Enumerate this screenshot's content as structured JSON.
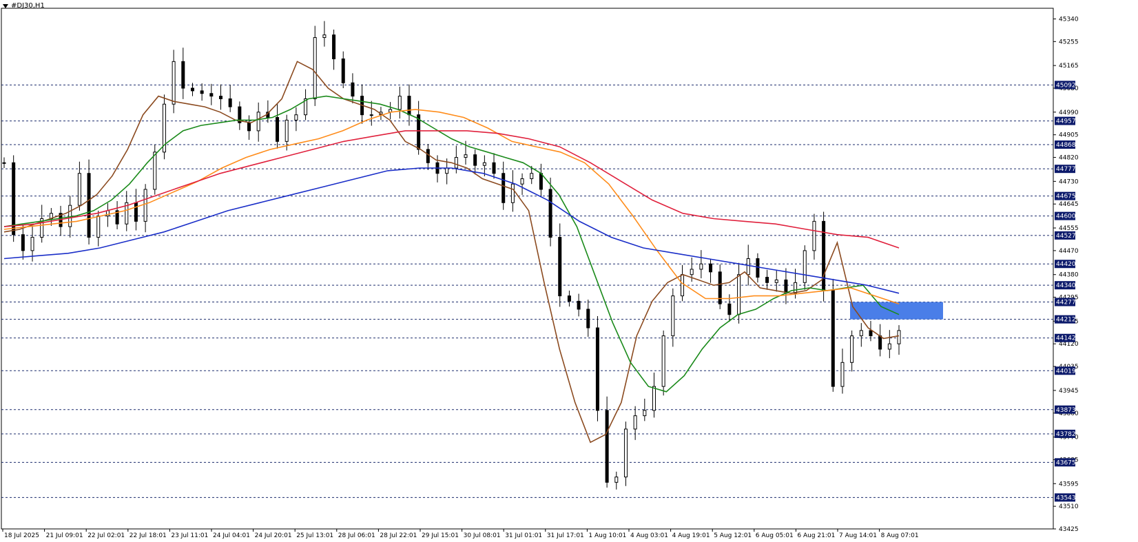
{
  "window": {
    "symbol_title": "#DJ30,H1"
  },
  "chart_data": {
    "type": "candlestick",
    "title": "#DJ30,H1",
    "ylim": [
      43425,
      45380
    ],
    "x_tick_labels": [
      "18 Jul 2025",
      "21 Jul 09:01",
      "22 Jul 02:01",
      "22 Jul 18:01",
      "23 Jul 11:01",
      "24 Jul 04:01",
      "24 Jul 20:01",
      "25 Jul 13:01",
      "28 Jul 06:01",
      "28 Jul 22:01",
      "29 Jul 15:01",
      "30 Jul 08:01",
      "31 Jul 01:01",
      "31 Jul 17:01",
      "1 Aug 10:01",
      "4 Aug 03:01",
      "4 Aug 19:01",
      "5 Aug 12:01",
      "6 Aug 05:01",
      "6 Aug 21:01",
      "7 Aug 14:01",
      "8 Aug 07:01"
    ],
    "y_tick_labels": [
      "45340",
      "45255",
      "45165",
      "45080",
      "44990",
      "44905",
      "44820",
      "44730",
      "44645",
      "44555",
      "44470",
      "44380",
      "44295",
      "44205",
      "44120",
      "44035",
      "43945",
      "43860",
      "43770",
      "43685",
      "43595",
      "43510",
      "43425"
    ],
    "horizontal_levels": [
      "45092",
      "44957",
      "44868",
      "44777",
      "44675",
      "44600",
      "44527",
      "44420",
      "44340",
      "44277",
      "44212",
      "44142",
      "44019",
      "43873",
      "43782",
      "43675",
      "43543"
    ],
    "level_tag_color": "#0c1a6b",
    "zone": {
      "from": 44212,
      "to": 44277,
      "color": "#4a7ee8"
    },
    "price_series": [
      44800,
      44530,
      44470,
      44520,
      44590,
      44610,
      44560,
      44640,
      44760,
      44520,
      44600,
      44620,
      44570,
      44650,
      44580,
      44700,
      44840,
      45020,
      45180,
      45080,
      45070,
      45060,
      45050,
      45040,
      45010,
      44950,
      44920,
      44990,
      44970,
      44880,
      44960,
      44980,
      45040,
      45270,
      45280,
      45190,
      45100,
      45050,
      44980,
      44980,
      44990,
      45000,
      45050,
      44980,
      44850,
      44800,
      44760,
      44780,
      44820,
      44830,
      44790,
      44800,
      44760,
      44650,
      44720,
      44740,
      44760,
      44700,
      44520,
      44300,
      44280,
      44250,
      44180,
      43870,
      43600,
      43620,
      43800,
      43850,
      43870,
      43960,
      44150,
      44300,
      44380,
      44400,
      44420,
      44390,
      44270,
      44230,
      44380,
      44440,
      44370,
      44350,
      44360,
      44310,
      44350,
      44470,
      44580,
      44320,
      43960,
      44050,
      44150,
      44170,
      44150,
      44100,
      44120,
      44170
    ],
    "series": [
      {
        "values": [
          44540,
          44550,
          44570,
          44590,
          44610,
          44640,
          44680,
          44750,
          44850,
          44980,
          45050,
          45030,
          45020,
          45010,
          44990,
          44960,
          44950,
          44980,
          45040,
          45180,
          45150,
          45080,
          45040,
          45020,
          45000,
          44960,
          44880,
          44850,
          44810,
          44800,
          44780,
          44740,
          44720,
          44700,
          44620,
          44350,
          44100,
          43900,
          43750,
          43780,
          43900,
          44150,
          44280,
          44350,
          44380,
          44360,
          44340,
          44350,
          44390,
          44330,
          44320,
          44310,
          44320,
          44360,
          44500,
          44260,
          44180,
          44140,
          44150
        ],
        "color": "#8b4a1f"
      },
      {
        "values": [
          44560,
          44570,
          44580,
          44590,
          44600,
          44620,
          44660,
          44720,
          44800,
          44870,
          44920,
          44940,
          44950,
          44960,
          44960,
          44970,
          45000,
          45040,
          45050,
          45040,
          45030,
          45020,
          45000,
          44970,
          44930,
          44890,
          44860,
          44840,
          44820,
          44800,
          44760,
          44680,
          44560,
          44380,
          44200,
          44050,
          43960,
          43940,
          44000,
          44100,
          44180,
          44230,
          44250,
          44290,
          44320,
          44330,
          44320,
          44330,
          44340,
          44260,
          44230
        ],
        "color": "#1a8a1a"
      },
      {
        "values": [
          44550,
          44560,
          44570,
          44580,
          44600,
          44620,
          44650,
          44690,
          44730,
          44780,
          44820,
          44850,
          44870,
          44890,
          44920,
          44960,
          44990,
          45000,
          44990,
          44970,
          44930,
          44880,
          44860,
          44840,
          44800,
          44720,
          44600,
          44470,
          44350,
          44290,
          44290,
          44300,
          44300,
          44310,
          44320,
          44330,
          44300,
          44270
        ],
        "color": "#ff8c1a"
      },
      {
        "values": [
          44560,
          44570,
          44590,
          44610,
          44640,
          44680,
          44720,
          44760,
          44790,
          44820,
          44850,
          44880,
          44900,
          44920,
          44920,
          44920,
          44910,
          44890,
          44860,
          44800,
          44730,
          44660,
          44610,
          44590,
          44580,
          44570,
          44550,
          44530,
          44520,
          44480
        ],
        "color": "#e0203c"
      },
      {
        "values": [
          44440,
          44450,
          44460,
          44480,
          44510,
          44540,
          44580,
          44620,
          44650,
          44680,
          44710,
          44740,
          44770,
          44780,
          44780,
          44760,
          44720,
          44660,
          44580,
          44520,
          44480,
          44460,
          44440,
          44420,
          44400,
          44380,
          44360,
          44340,
          44310
        ],
        "color": "#1a2ec8"
      }
    ]
  }
}
